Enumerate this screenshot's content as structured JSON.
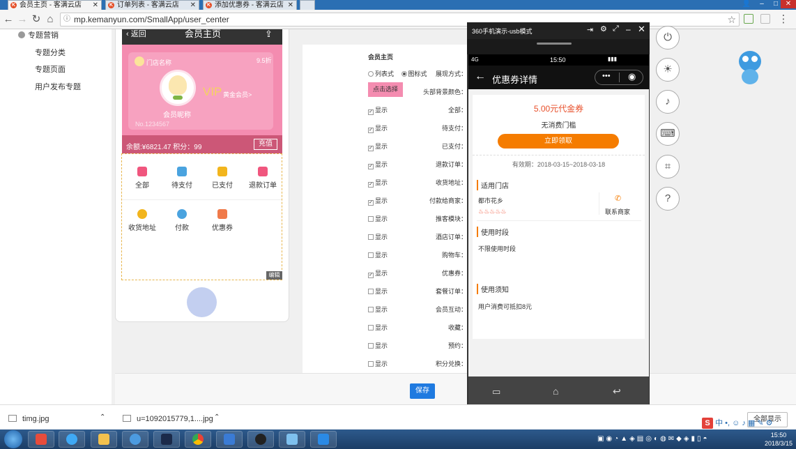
{
  "browser": {
    "tabs": [
      {
        "label": "会员主页 - 客满云店"
      },
      {
        "label": "订单列表 - 客满云店"
      },
      {
        "label": "添加优惠券 - 客满云店"
      }
    ],
    "url": "mp.kemanyun.com/SmallApp/user_center"
  },
  "sidebar": {
    "section": "专题营销",
    "items": [
      "专题分类",
      "专题页面",
      "用户发布专题"
    ]
  },
  "preview": {
    "back_label": "返回",
    "title": "会员主页",
    "store_name": "门店名称",
    "discount": "9.5折",
    "vip": "VIP",
    "vip_level": "黄金会员>",
    "nickname": "会员昵称",
    "member_no": "No.1234567",
    "balance_text": "余额:¥6821.47 积分：99",
    "recharge": "充值",
    "grid": [
      {
        "label": "全部",
        "color": "#f0567e"
      },
      {
        "label": "待支付",
        "color": "#4aa3df"
      },
      {
        "label": "已支付",
        "color": "#f2b51d"
      },
      {
        "label": "退款订单",
        "color": "#f0567e"
      },
      {
        "label": "收货地址",
        "color": "#f2b51d"
      },
      {
        "label": "付款",
        "color": "#4aa3df"
      },
      {
        "label": "优惠券",
        "color": "#f07a4a"
      }
    ],
    "edit": "编辑"
  },
  "settings": {
    "title": "会员主页",
    "display_mode_label": "展现方式：",
    "mode_list": "列表式",
    "mode_icon": "图标式",
    "mode_selected": "图标式",
    "bg_color_label": "头部背景颜色：",
    "bg_color_button": "点击选择",
    "bg_color": "#f48cb0",
    "show_label": "显示",
    "rows": [
      {
        "label": "全部：",
        "checked": true
      },
      {
        "label": "待支付：",
        "checked": true
      },
      {
        "label": "已支付：",
        "checked": true
      },
      {
        "label": "退款订单：",
        "checked": true
      },
      {
        "label": "收货地址：",
        "checked": true
      },
      {
        "label": "付款给商家：",
        "checked": true
      },
      {
        "label": "推客模块：",
        "checked": false
      },
      {
        "label": "酒店订单：",
        "checked": false
      },
      {
        "label": "购物车：",
        "checked": false
      },
      {
        "label": "优惠券：",
        "checked": true
      },
      {
        "label": "套餐订单：",
        "checked": false
      },
      {
        "label": "会员互动：",
        "checked": false
      },
      {
        "label": "收藏：",
        "checked": false
      },
      {
        "label": "预约：",
        "checked": false
      },
      {
        "label": "积分兑换：",
        "checked": false
      }
    ],
    "save": "保存"
  },
  "emulator": {
    "title": "360手机演示-usb模式",
    "status_time": "15:50",
    "status_net": "4G",
    "page_title": "优惠券详情",
    "coupon_name": "5.00元代金券",
    "threshold": "无消费门槛",
    "claim": "立即领取",
    "validity": "有效期：2018-03-15~2018-03-18",
    "stores_heading": "适用门店",
    "store": "都市花乡",
    "contact": "联系商家",
    "period_heading": "使用时段",
    "period_text": "不限使用时段",
    "notice_heading": "使用须知",
    "notice_text": "用户消费可抵扣8元"
  },
  "downloads": [
    {
      "name": "timg.jpg"
    },
    {
      "name": "u=1092015779,1....jpg"
    }
  ],
  "downloads_show_all": "全部显示",
  "clock": {
    "time": "15:50",
    "date": "2018/3/15"
  },
  "colors": {
    "accent": "#1f7ae0",
    "coupon_orange": "#f57c00",
    "pink": "#f48cb0"
  }
}
